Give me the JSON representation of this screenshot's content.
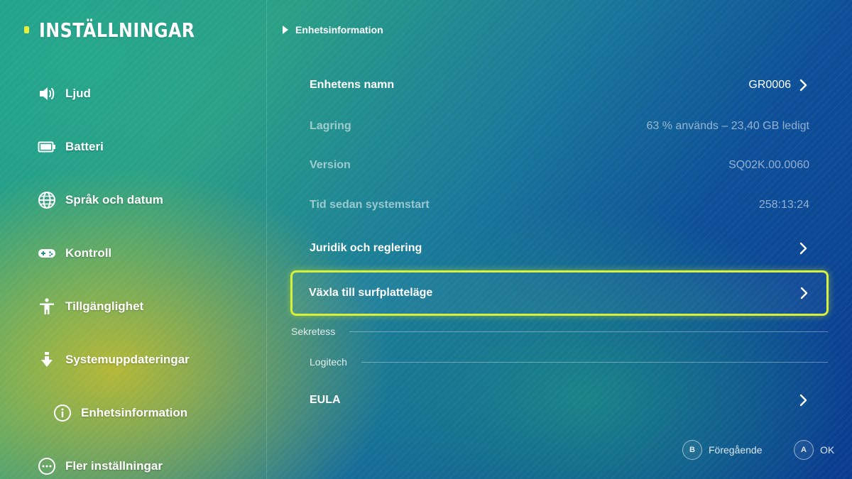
{
  "app_title": "INSTÄLLNINGAR",
  "sidebar": {
    "items": [
      {
        "label": "Ljud",
        "icon": "speaker-icon"
      },
      {
        "label": "Batteri",
        "icon": "battery-icon"
      },
      {
        "label": "Språk och datum",
        "icon": "globe-icon"
      },
      {
        "label": "Kontroll",
        "icon": "gamepad-icon"
      },
      {
        "label": "Tillgänglighet",
        "icon": "accessibility-icon"
      },
      {
        "label": "Systemuppdateringar",
        "icon": "download-arrow-icon"
      },
      {
        "label": "Enhetsinformation",
        "icon": "info-icon"
      },
      {
        "label": "Fler inställningar",
        "icon": "more-icon"
      }
    ]
  },
  "breadcrumb": "Enhetsinformation",
  "main": {
    "device_name": {
      "label": "Enhetens namn",
      "value": "GR0006"
    },
    "storage": {
      "label": "Lagring",
      "value": "63 % används – 23,40 GB ledigt"
    },
    "version": {
      "label": "Version",
      "value": "SQ02K.00.0060"
    },
    "uptime": {
      "label": "Tid sedan systemstart",
      "value": "258:13:24"
    },
    "legal": {
      "label": "Juridik och reglering"
    },
    "tablet_mode": {
      "label": "Växla till surfplatteläge"
    },
    "privacy_section": "Sekretess",
    "logitech_section": "Logitech",
    "eula": {
      "label": "EULA"
    }
  },
  "footer": {
    "back": {
      "key": "B",
      "label": "Föregående"
    },
    "ok": {
      "key": "A",
      "label": "OK"
    }
  },
  "colors": {
    "focus": "#d6f03c",
    "title_dot": "#e8f03c"
  }
}
